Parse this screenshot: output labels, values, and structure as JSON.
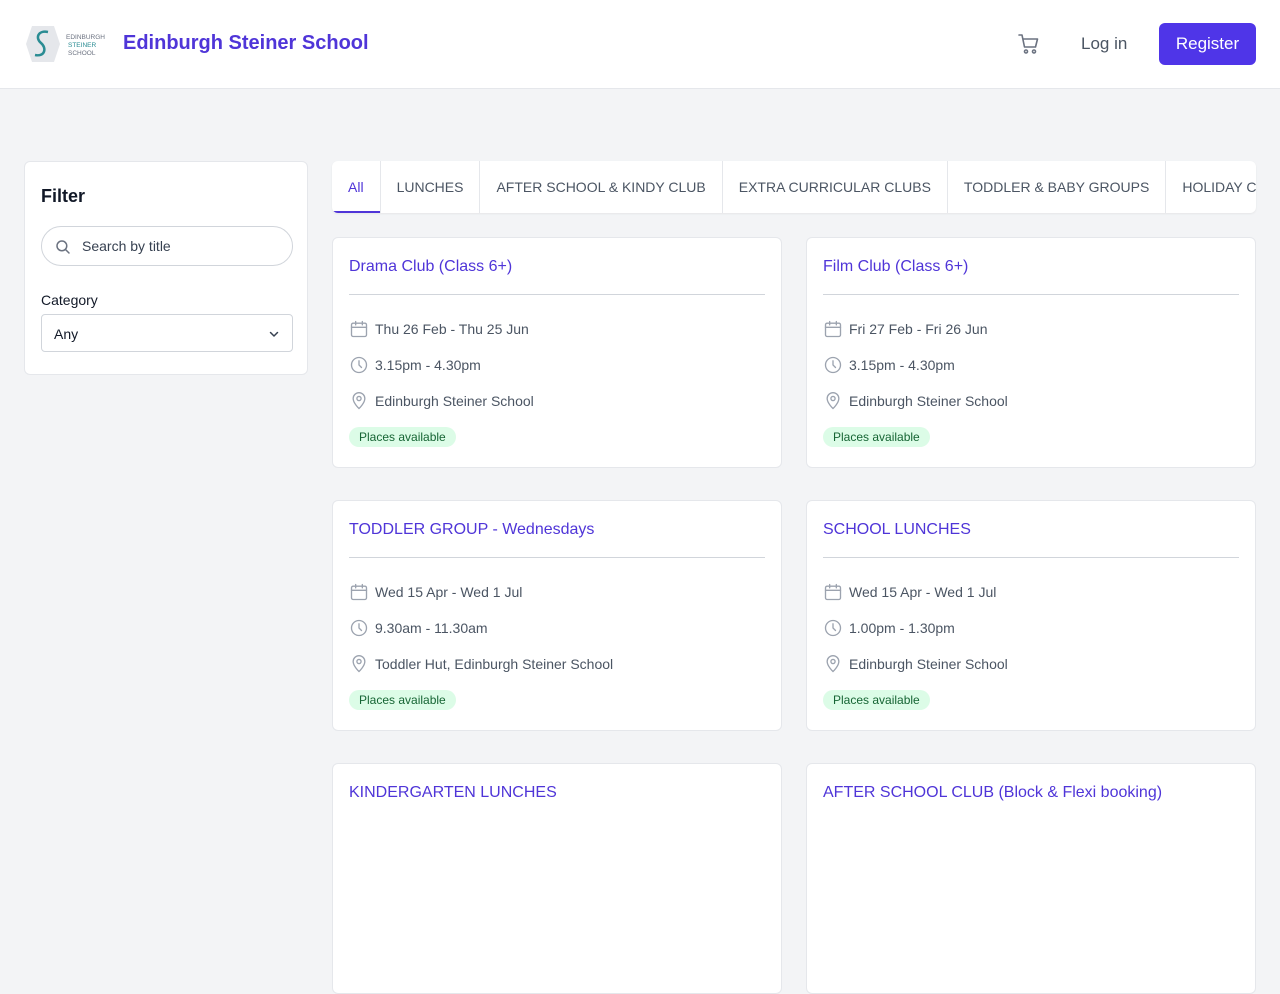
{
  "header": {
    "brand": "Edinburgh Steiner School",
    "logo_text": "EDINBURGH STEINER SCHOOL",
    "login_label": "Log in",
    "register_label": "Register"
  },
  "filter": {
    "title": "Filter",
    "search_placeholder": "Search by title",
    "category_label": "Category",
    "category_value": "Any"
  },
  "tabs": [
    {
      "label": "All",
      "active": true
    },
    {
      "label": "LUNCHES"
    },
    {
      "label": "AFTER SCHOOL & KINDY CLUB"
    },
    {
      "label": "EXTRA CURRICULAR CLUBS"
    },
    {
      "label": "TODDLER & BABY GROUPS"
    },
    {
      "label": "HOLIDAY CAMPS"
    }
  ],
  "cards": [
    {
      "title": "Drama Club (Class 6+)",
      "dates": "Thu 26 Feb - Thu 25 Jun",
      "time": "3.15pm - 4.30pm",
      "location": "Edinburgh Steiner School",
      "status": "Places available"
    },
    {
      "title": "Film Club (Class 6+)",
      "dates": "Fri 27 Feb - Fri 26 Jun",
      "time": "3.15pm - 4.30pm",
      "location": "Edinburgh Steiner School",
      "status": "Places available"
    },
    {
      "title": "TODDLER GROUP - Wednesdays",
      "dates": "Wed 15 Apr - Wed 1 Jul",
      "time": "9.30am - 11.30am",
      "location": "Toddler Hut, Edinburgh Steiner School",
      "status": "Places available"
    },
    {
      "title": "SCHOOL LUNCHES",
      "dates": "Wed 15 Apr - Wed 1 Jul",
      "time": "1.00pm - 1.30pm",
      "location": "Edinburgh Steiner School",
      "status": "Places available"
    },
    {
      "title": "KINDERGARTEN LUNCHES"
    },
    {
      "title": "AFTER SCHOOL CLUB (Block & Flexi booking)"
    }
  ],
  "icons": {
    "cart": "shopping-cart-icon",
    "search": "search-icon",
    "chevron": "chevron-down-icon",
    "calendar": "calendar-icon",
    "clock": "clock-icon",
    "location": "map-pin-icon"
  },
  "colors": {
    "accent": "#4f35d8",
    "badge_bg": "#dcfce7",
    "badge_text": "#166534",
    "page_bg": "#f3f4f6"
  }
}
